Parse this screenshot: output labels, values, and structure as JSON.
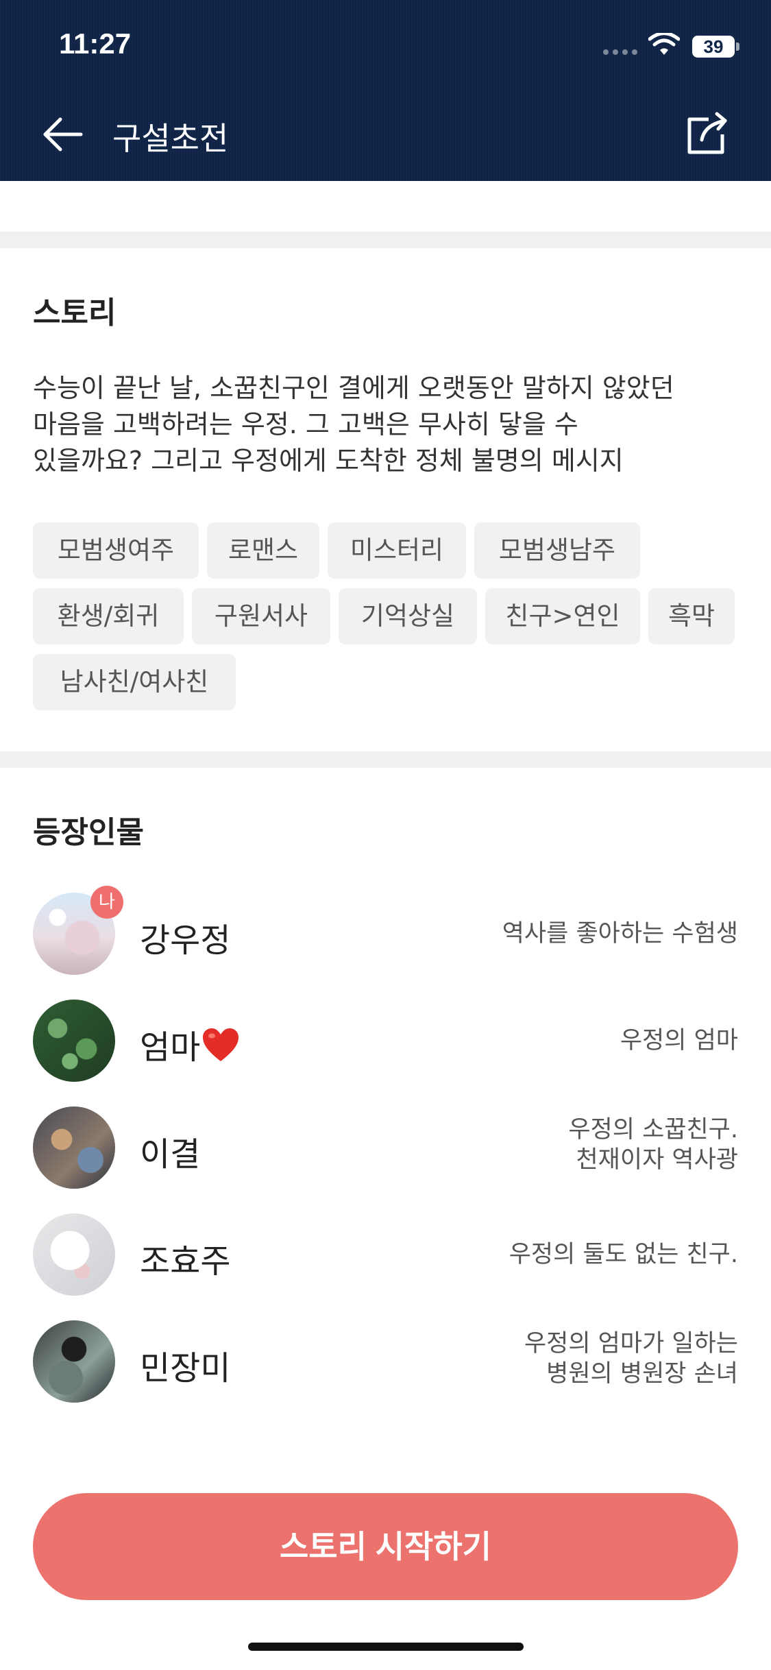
{
  "status_bar": {
    "time": "11:27",
    "battery_level": "39"
  },
  "header": {
    "title": "구설초전",
    "back_icon": "arrow-left-icon",
    "share_icon": "share-icon",
    "background_color": "#0f2547"
  },
  "story": {
    "section_title": "스토리",
    "description": "수능이 끝난 날, 소꿉친구인 결에게 오랫동안 말하지 않았던\n마음을 고백하려는 우정. 그 고백은 무사히 닿을 수\n있을까요? 그리고 우정에게 도착한 정체 불명의 메시지",
    "tags": [
      "모범생여주",
      "로맨스",
      "미스터리",
      "모범생남주",
      "환생/회귀",
      "구원서사",
      "기억상실",
      "친구>연인",
      "흑막",
      "남사친/여사친"
    ]
  },
  "characters": {
    "section_title": "등장인물",
    "me_badge": "나",
    "items": [
      {
        "name": "강우정",
        "description": "역사를 좋아하는 수험생",
        "is_me": true
      },
      {
        "name": "엄마",
        "name_icon": "red-heart-icon",
        "description": "우정의 엄마"
      },
      {
        "name": "이결",
        "description": "우정의 소꿉친구.\n천재이자 역사광"
      },
      {
        "name": "조효주",
        "description": "우정의 둘도 없는 친구."
      },
      {
        "name": "민장미",
        "description": "우정의 엄마가 일하는\n병원의 병원장 손녀"
      }
    ]
  },
  "actions": {
    "start_button": "스토리 시작하기",
    "accent_color": "#ec726e"
  }
}
